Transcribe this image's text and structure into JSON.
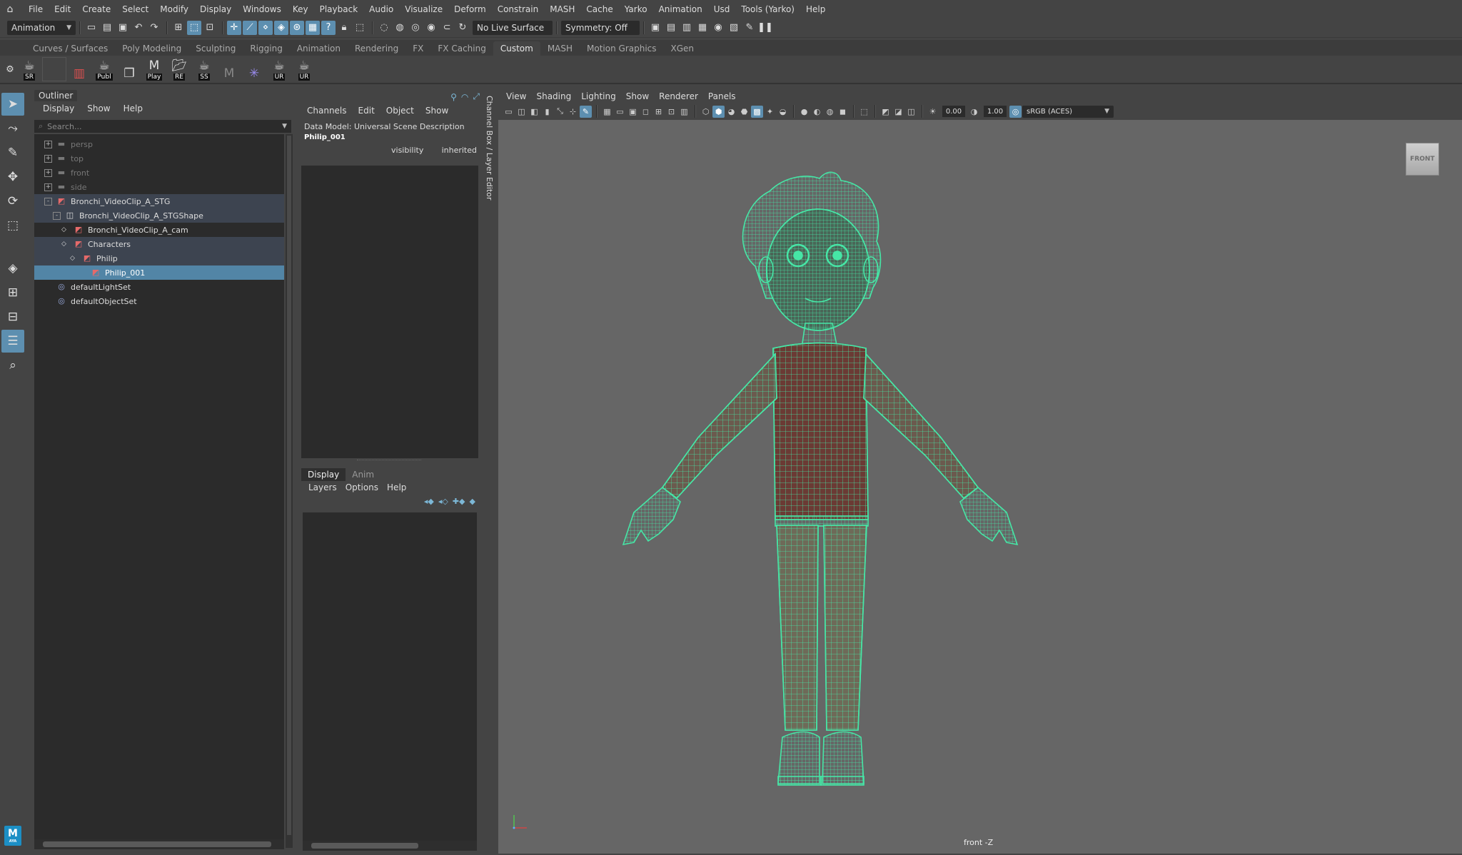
{
  "menubar": {
    "items": [
      "File",
      "Edit",
      "Create",
      "Select",
      "Modify",
      "Display",
      "Windows",
      "Key",
      "Playback",
      "Audio",
      "Visualize",
      "Deform",
      "Constrain",
      "MASH",
      "Cache",
      "Yarko",
      "Animation",
      "Usd",
      "Tools (Yarko)",
      "Help"
    ]
  },
  "statusline": {
    "menuset": "Animation",
    "live_surface": "No Live Surface",
    "symmetry": "Symmetry: Off"
  },
  "shelf": {
    "tabs": [
      "Curves / Surfaces",
      "Poly Modeling",
      "Sculpting",
      "Rigging",
      "Animation",
      "Rendering",
      "FX",
      "FX Caching",
      "Custom",
      "MASH",
      "Motion Graphics",
      "XGen"
    ],
    "active_tab": "Custom",
    "buttons": [
      {
        "label": "SR",
        "icon": "teapot-icon"
      },
      {
        "label": "",
        "icon": "blank-icon"
      },
      {
        "label": "",
        "icon": "film-strip-icon"
      },
      {
        "label": "Publ",
        "icon": "teapot-icon"
      },
      {
        "label": "",
        "icon": "layers-icon"
      },
      {
        "label": "Play",
        "icon": "maya-m-icon"
      },
      {
        "label": "RE",
        "icon": "folder-icon"
      },
      {
        "label": "SS",
        "icon": "teapot-icon"
      },
      {
        "label": "",
        "icon": "maya-m-grey-icon"
      },
      {
        "label": "",
        "icon": "asterisk-icon"
      },
      {
        "label": "UR",
        "icon": "teapot-icon"
      },
      {
        "label": "UR",
        "icon": "teapot-icon"
      }
    ]
  },
  "outliner": {
    "title": "Outliner",
    "menu": [
      "Display",
      "Show",
      "Help"
    ],
    "search_placeholder": "Search...",
    "rows": [
      {
        "label": "persp",
        "depth": 0,
        "state": "dim",
        "icon": "camera-icon",
        "expander": "+"
      },
      {
        "label": "top",
        "depth": 0,
        "state": "dim",
        "icon": "camera-icon",
        "expander": "+"
      },
      {
        "label": "front",
        "depth": 0,
        "state": "dim",
        "icon": "camera-icon",
        "expander": "+"
      },
      {
        "label": "side",
        "depth": 0,
        "state": "dim",
        "icon": "camera-icon",
        "expander": "+"
      },
      {
        "label": "Bronchi_VideoClip_A_STG",
        "depth": 0,
        "state": "grp",
        "icon": "usd-stage-icon",
        "expander": "-"
      },
      {
        "label": "Bronchi_VideoClip_A_STGShape",
        "depth": 1,
        "state": "grp",
        "icon": "shape-icon",
        "expander": "-"
      },
      {
        "label": "Bronchi_VideoClip_A_cam",
        "depth": 2,
        "state": "normal",
        "icon": "usd-prim-icon",
        "expander": "◇"
      },
      {
        "label": "Characters",
        "depth": 2,
        "state": "grp",
        "icon": "usd-prim-icon",
        "expander": "◇"
      },
      {
        "label": "Philip",
        "depth": 3,
        "state": "grp",
        "icon": "usd-prim-icon",
        "expander": "◇"
      },
      {
        "label": "Philip_001",
        "depth": 4,
        "state": "sel",
        "icon": "usd-prim-icon",
        "expander": ""
      },
      {
        "label": "defaultLightSet",
        "depth": 0,
        "state": "normal",
        "icon": "set-icon",
        "expander": ""
      },
      {
        "label": "defaultObjectSet",
        "depth": 0,
        "state": "normal",
        "icon": "set-icon",
        "expander": ""
      }
    ]
  },
  "channelbox": {
    "menu": [
      "Channels",
      "Edit",
      "Object",
      "Show"
    ],
    "data_model": "Data Model: Universal Scene Description",
    "node": "Philip_001",
    "attr_name": "visibility",
    "attr_value": "inherited",
    "vertical_tab": "Channel Box / Layer Editor"
  },
  "layereditor": {
    "tabs": [
      "Display",
      "Anim"
    ],
    "active_tab": "Display",
    "menu": [
      "Layers",
      "Options",
      "Help"
    ]
  },
  "viewport": {
    "menu": [
      "View",
      "Shading",
      "Lighting",
      "Show",
      "Renderer",
      "Panels"
    ],
    "near_value": "0.00",
    "far_value": "1.00",
    "color_space": "sRGB (ACES)",
    "view_cube": "FRONT",
    "camera_label": "front -Z",
    "wire_color": "#46e6a6"
  },
  "logo": {
    "text": "M",
    "sub": "AYA"
  }
}
